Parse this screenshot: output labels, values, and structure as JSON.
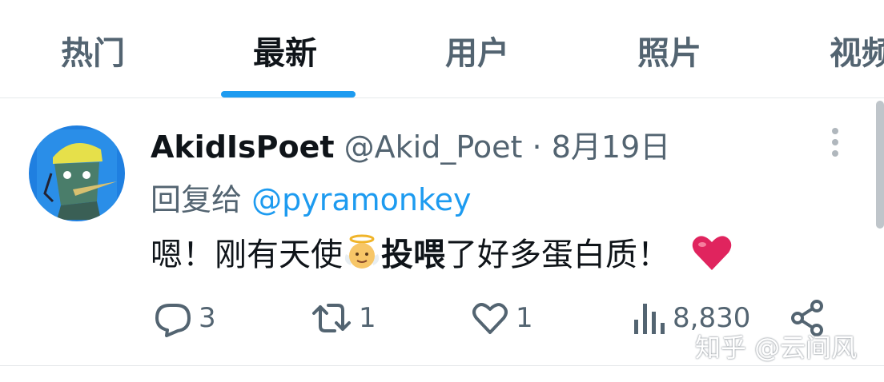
{
  "tabs": [
    {
      "label": "热门",
      "active": false
    },
    {
      "label": "最新",
      "active": true
    },
    {
      "label": "用户",
      "active": false
    },
    {
      "label": "照片",
      "active": false
    },
    {
      "label": "视频",
      "active": false
    }
  ],
  "tweet": {
    "display_name": "AkidIsPoet",
    "handle": "@Akid_Poet",
    "separator": "·",
    "date": "8月19日",
    "reply_prefix": "回复给",
    "reply_to": "@pyramonkey",
    "text_part1": "嗯！刚有天使",
    "text_bold": "投喂",
    "text_part2": "了好多蛋白质！",
    "emoji_angel": "angel-emoji",
    "emoji_heart": "red-heart-emoji",
    "stats": {
      "replies": "3",
      "retweets": "1",
      "likes": "1",
      "views": "8,830"
    }
  },
  "watermark": "知乎 @云间风",
  "colors": {
    "accent": "#1d9bf0",
    "text": "#0f1419",
    "muted": "#536471",
    "heart": "#e0245e"
  }
}
